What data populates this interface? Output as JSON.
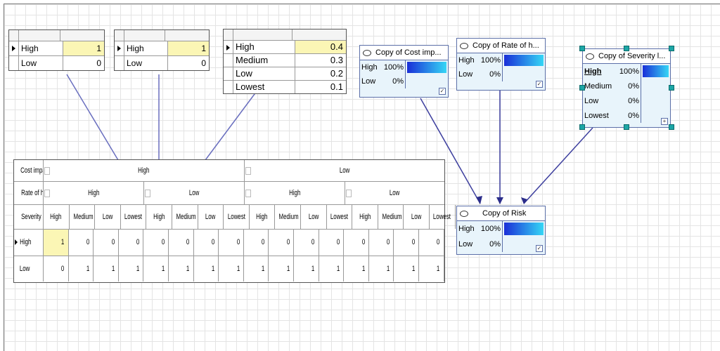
{
  "tables": {
    "cost": {
      "rows": [
        {
          "label": "High",
          "value": "1",
          "selected": true
        },
        {
          "label": "Low",
          "value": "0",
          "selected": false
        }
      ]
    },
    "rate": {
      "rows": [
        {
          "label": "High",
          "value": "1",
          "selected": true
        },
        {
          "label": "Low",
          "value": "0",
          "selected": false
        }
      ]
    },
    "severity": {
      "rows": [
        {
          "label": "High",
          "value": "0.4",
          "selected": true
        },
        {
          "label": "Medium",
          "value": "0.3",
          "selected": false
        },
        {
          "label": "Low",
          "value": "0.2",
          "selected": false
        },
        {
          "label": "Lowest",
          "value": "0.1",
          "selected": false
        }
      ]
    }
  },
  "nodes": {
    "cost": {
      "title": "Copy of Cost imp...",
      "states": [
        {
          "label": "High",
          "pct": "100%",
          "fraction": 1.0
        },
        {
          "label": "Low",
          "pct": "0%",
          "fraction": 0.0
        }
      ]
    },
    "rate": {
      "title": "Copy of Rate of h...",
      "states": [
        {
          "label": "High",
          "pct": "100%",
          "fraction": 1.0
        },
        {
          "label": "Low",
          "pct": "0%",
          "fraction": 0.0
        }
      ]
    },
    "severity": {
      "title": "Copy of Severity l...",
      "states": [
        {
          "label": "High",
          "pct": "100%",
          "fraction": 1.0
        },
        {
          "label": "Medium",
          "pct": "0%",
          "fraction": 0.0
        },
        {
          "label": "Low",
          "pct": "0%",
          "fraction": 0.0
        },
        {
          "label": "Lowest",
          "pct": "0%",
          "fraction": 0.0
        }
      ]
    },
    "risk": {
      "title": "Copy of Risk",
      "states": [
        {
          "label": "High",
          "pct": "100%",
          "fraction": 1.0
        },
        {
          "label": "Low",
          "pct": "0%",
          "fraction": 0.0
        }
      ]
    }
  },
  "cpt": {
    "row_labels": {
      "cost": "Cost impact",
      "rate": "Rate of hos...",
      "severity": "Severity lev..."
    },
    "cost_states": [
      "High",
      "Low"
    ],
    "rate_states": [
      "High",
      "Low",
      "High",
      "Low"
    ],
    "severity_states": [
      "High",
      "Medium",
      "Low",
      "Lowest",
      "High",
      "Medium",
      "Low",
      "Lowest",
      "High",
      "Medium",
      "Low",
      "Lowest",
      "High",
      "Medium",
      "Low",
      "Lowest"
    ],
    "outcomes": [
      {
        "label": "High",
        "values": [
          "1",
          "0",
          "0",
          "0",
          "0",
          "0",
          "0",
          "0",
          "0",
          "0",
          "0",
          "0",
          "0",
          "0",
          "0",
          "0"
        ]
      },
      {
        "label": "Low",
        "values": [
          "0",
          "1",
          "1",
          "1",
          "1",
          "1",
          "1",
          "1",
          "1",
          "1",
          "1",
          "1",
          "1",
          "1",
          "1",
          "1"
        ]
      }
    ]
  },
  "colors": {
    "grid": "#e4e4e4",
    "node_border": "#5b6fa8",
    "node_bg": "#e8f4fb",
    "bar_start": "#1a2fd8",
    "bar_end": "#35d6f5",
    "highlight": "#fbf6b5",
    "link": "#6a6fbf"
  }
}
